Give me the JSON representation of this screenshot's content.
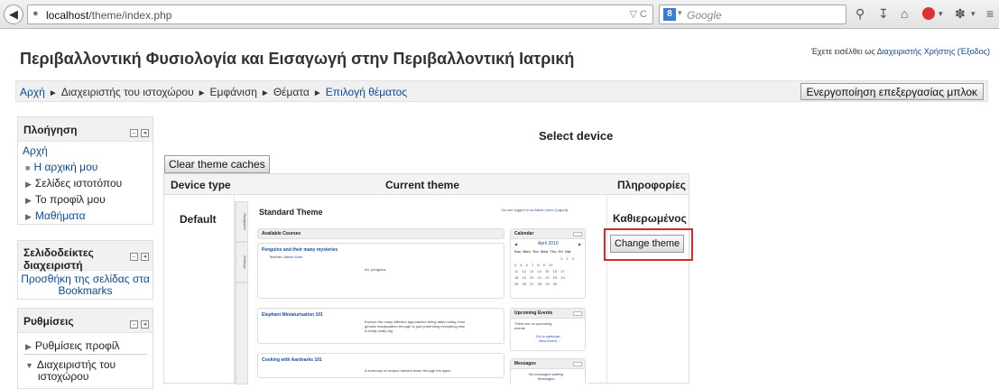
{
  "browser": {
    "url_host": "localhost",
    "url_path": "/theme/index.php",
    "search_engine_badge": "8",
    "search_placeholder": "Google",
    "icons": [
      "back-arrow-icon",
      "globe-icon",
      "reload-icon",
      "search-icon",
      "download-icon",
      "home-icon",
      "abp-icon",
      "menu-icon"
    ]
  },
  "page": {
    "title": "Περιβαλλοντική Φυσιολογία και Εισαγωγή στην Περιβαλλοντική Ιατρική",
    "login_prefix": "Έχετε εισέλθει ως ",
    "login_user": "Διαχειριστής Χρήστης",
    "login_logout": "(Έξοδος)"
  },
  "breadcrumb": {
    "items": [
      "Αρχή",
      "Διαχειριστής του ιστοχώρου",
      "Εμφάνιση",
      "Θέματα",
      "Επιλογή θέματος"
    ],
    "separator": "►",
    "edit_button": "Ενεργοποίηση επεξεργασίας μπλοκ"
  },
  "blocks": {
    "navigation": {
      "title": "Πλοήγηση",
      "home": "Αρχή",
      "items": [
        "Η αρχική μου",
        "Σελίδες ιστοτόπου",
        "Το προφίλ μου",
        "Μαθήματα"
      ]
    },
    "bookmarks": {
      "title_line1": "Σελιδοδείκτες",
      "title_line2": "διαχειριστή",
      "link_line1": "Προσθήκη της σελίδας στα",
      "link_line2": "Bookmarks"
    },
    "settings": {
      "title": "Ρυθμίσεις",
      "items": [
        "Ρυθμίσεις προφίλ",
        "Διαχειριστής του",
        "ιστοχώρου"
      ]
    }
  },
  "main": {
    "heading": "Select device",
    "clear_caches_button": "Clear theme caches",
    "table": {
      "headers": [
        "Device type",
        "Current theme",
        "Πληροφορίες"
      ],
      "device": "Default",
      "theme_label": "Καθιερωμένος",
      "change_button": "Change theme"
    },
    "highlight_color": "#d32a2a"
  },
  "preview": {
    "tab_navigation": "Navigation",
    "tab_settings": "Settings",
    "title": "Standard Theme",
    "login_text": "You are logged in as",
    "login_user": "Admin User",
    "login_logout": "(Logout)",
    "available_courses": "Available Courses",
    "courses": [
      {
        "title": "Penguins and their many mysteries",
        "teacher_label": "Teacher:",
        "teacher": "Admin User",
        "summary": "Ah, penguins."
      },
      {
        "title": "Elephant Miniaturisation 101",
        "summary_lines": [
          "Explore the many different approaches being taken today, from",
          "genetic manipulation through to just pretending everything else",
          "is really really big."
        ]
      },
      {
        "title": "Cooking with Aardvarks 101",
        "summary": "A summary of recipes handed down through the ages."
      }
    ],
    "calendar": {
      "title": "Calendar",
      "month": "April 2010",
      "days_header": "Sun Mon Tue Wed Thu Fri Sat",
      "rows": [
        "1 2 3",
        "4 5 6 7 8 9 10",
        "11 12 13 14 15 16 17",
        "18 19 20 21 22 23 24",
        "25 26 27 28 29 30"
      ]
    },
    "upcoming": {
      "title": "Upcoming Events",
      "text_line1": "There are no upcoming",
      "text_line2": "events",
      "link1": "Go to calendar...",
      "link2": "New Event..."
    },
    "messages": {
      "title": "Messages",
      "text": "No messages waiting",
      "link": "Messages..."
    }
  }
}
